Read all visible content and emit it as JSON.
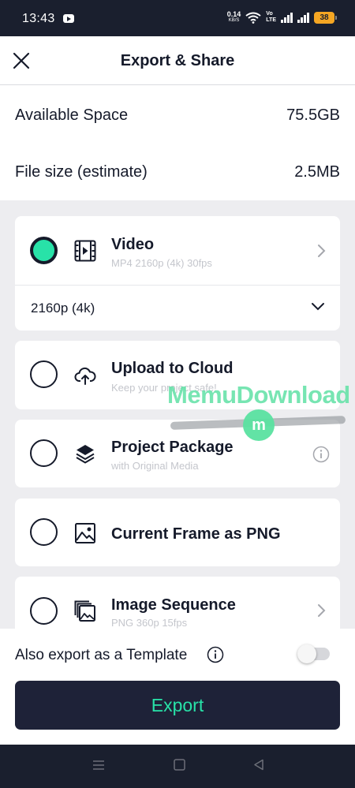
{
  "status_bar": {
    "time": "13:43",
    "net_speed": "0.14",
    "net_unit": "KB/S",
    "volte_top": "Vo",
    "volte_bottom": "LTE",
    "battery": "38"
  },
  "header": {
    "title": "Export & Share"
  },
  "info": {
    "available_space_label": "Available Space",
    "available_space_value": "75.5GB",
    "file_size_label": "File size (estimate)",
    "file_size_value": "2.5MB"
  },
  "options": {
    "video": {
      "title": "Video",
      "subtitle": "MP4 2160p (4k) 30fps",
      "selected": true
    },
    "resolution": {
      "value": "2160p (4k)"
    },
    "cloud": {
      "title": "Upload to Cloud",
      "subtitle": "Keep your project safe!"
    },
    "package": {
      "title": "Project Package",
      "subtitle": "with Original Media"
    },
    "png": {
      "title": "Current Frame as PNG"
    },
    "sequence": {
      "title": "Image Sequence",
      "subtitle": "PNG 360p 15fps"
    }
  },
  "watermark": {
    "text": "MemuDownload",
    "glyph": "m"
  },
  "bottom": {
    "template_label": "Also export as a Template",
    "template_enabled": false,
    "export_label": "Export"
  },
  "colors": {
    "accent": "#28e2a8",
    "dark": "#1e2238",
    "text": "#151a2a",
    "subtle": "#c4c6cc",
    "background": "#ededf0"
  }
}
